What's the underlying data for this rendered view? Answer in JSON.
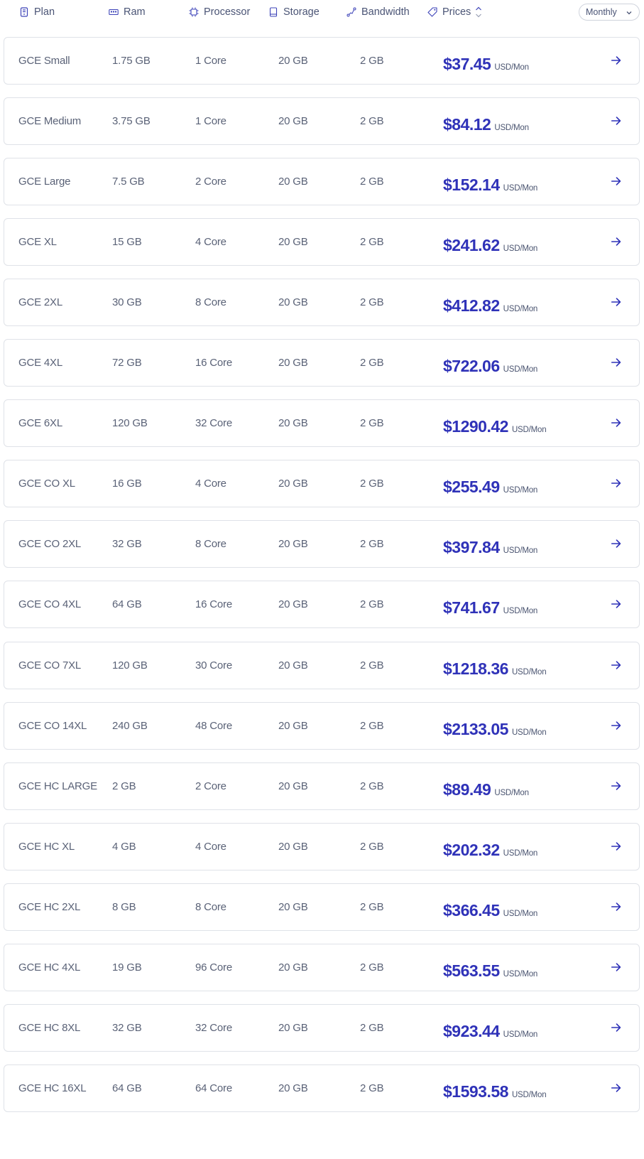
{
  "header": {
    "plan": "Plan",
    "ram": "Ram",
    "processor": "Processor",
    "storage": "Storage",
    "bandwidth": "Bandwidth",
    "prices": "Prices",
    "period": "Monthly"
  },
  "colors": {
    "accent": "#2f32b8",
    "text": "#5a6277",
    "border": "#dfe2e8"
  },
  "rows": [
    {
      "plan": "GCE Small",
      "ram": "1.75 GB",
      "processor": "1 Core",
      "storage": "20 GB",
      "bandwidth": "2 GB",
      "price": "$37.45",
      "unit": "USD/Mon"
    },
    {
      "plan": "GCE Medium",
      "ram": "3.75 GB",
      "processor": "1 Core",
      "storage": "20 GB",
      "bandwidth": "2 GB",
      "price": "$84.12",
      "unit": "USD/Mon"
    },
    {
      "plan": "GCE Large",
      "ram": "7.5 GB",
      "processor": "2 Core",
      "storage": "20 GB",
      "bandwidth": "2 GB",
      "price": "$152.14",
      "unit": "USD/Mon"
    },
    {
      "plan": "GCE XL",
      "ram": "15 GB",
      "processor": "4 Core",
      "storage": "20 GB",
      "bandwidth": "2 GB",
      "price": "$241.62",
      "unit": "USD/Mon"
    },
    {
      "plan": "GCE 2XL",
      "ram": "30 GB",
      "processor": "8 Core",
      "storage": "20 GB",
      "bandwidth": "2 GB",
      "price": "$412.82",
      "unit": "USD/Mon"
    },
    {
      "plan": "GCE 4XL",
      "ram": "72 GB",
      "processor": "16 Core",
      "storage": "20 GB",
      "bandwidth": "2 GB",
      "price": "$722.06",
      "unit": "USD/Mon"
    },
    {
      "plan": "GCE 6XL",
      "ram": "120 GB",
      "processor": "32 Core",
      "storage": "20 GB",
      "bandwidth": "2 GB",
      "price": "$1290.42",
      "unit": "USD/Mon"
    },
    {
      "plan": "GCE CO XL",
      "ram": "16 GB",
      "processor": "4 Core",
      "storage": "20 GB",
      "bandwidth": "2 GB",
      "price": "$255.49",
      "unit": "USD/Mon"
    },
    {
      "plan": "GCE CO 2XL",
      "ram": "32 GB",
      "processor": "8 Core",
      "storage": "20 GB",
      "bandwidth": "2 GB",
      "price": "$397.84",
      "unit": "USD/Mon"
    },
    {
      "plan": "GCE CO 4XL",
      "ram": "64 GB",
      "processor": "16 Core",
      "storage": "20 GB",
      "bandwidth": "2 GB",
      "price": "$741.67",
      "unit": "USD/Mon"
    },
    {
      "plan": "GCE CO 7XL",
      "ram": "120 GB",
      "processor": "30 Core",
      "storage": "20 GB",
      "bandwidth": "2 GB",
      "price": "$1218.36",
      "unit": "USD/Mon"
    },
    {
      "plan": "GCE CO 14XL",
      "ram": "240 GB",
      "processor": "48 Core",
      "storage": "20 GB",
      "bandwidth": "2 GB",
      "price": "$2133.05",
      "unit": "USD/Mon"
    },
    {
      "plan": "GCE HC LARGE",
      "ram": "2 GB",
      "processor": "2 Core",
      "storage": "20 GB",
      "bandwidth": "2 GB",
      "price": "$89.49",
      "unit": "USD/Mon"
    },
    {
      "plan": "GCE HC XL",
      "ram": "4 GB",
      "processor": "4 Core",
      "storage": "20 GB",
      "bandwidth": "2 GB",
      "price": "$202.32",
      "unit": "USD/Mon"
    },
    {
      "plan": "GCE HC 2XL",
      "ram": "8 GB",
      "processor": "8 Core",
      "storage": "20 GB",
      "bandwidth": "2 GB",
      "price": "$366.45",
      "unit": "USD/Mon"
    },
    {
      "plan": "GCE HC 4XL",
      "ram": "19 GB",
      "processor": "96 Core",
      "storage": "20 GB",
      "bandwidth": "2 GB",
      "price": "$563.55",
      "unit": "USD/Mon"
    },
    {
      "plan": "GCE HC 8XL",
      "ram": "32 GB",
      "processor": "32 Core",
      "storage": "20 GB",
      "bandwidth": "2 GB",
      "price": "$923.44",
      "unit": "USD/Mon"
    },
    {
      "plan": "GCE HC 16XL",
      "ram": "64 GB",
      "processor": "64 Core",
      "storage": "20 GB",
      "bandwidth": "2 GB",
      "price": "$1593.58",
      "unit": "USD/Mon"
    }
  ]
}
